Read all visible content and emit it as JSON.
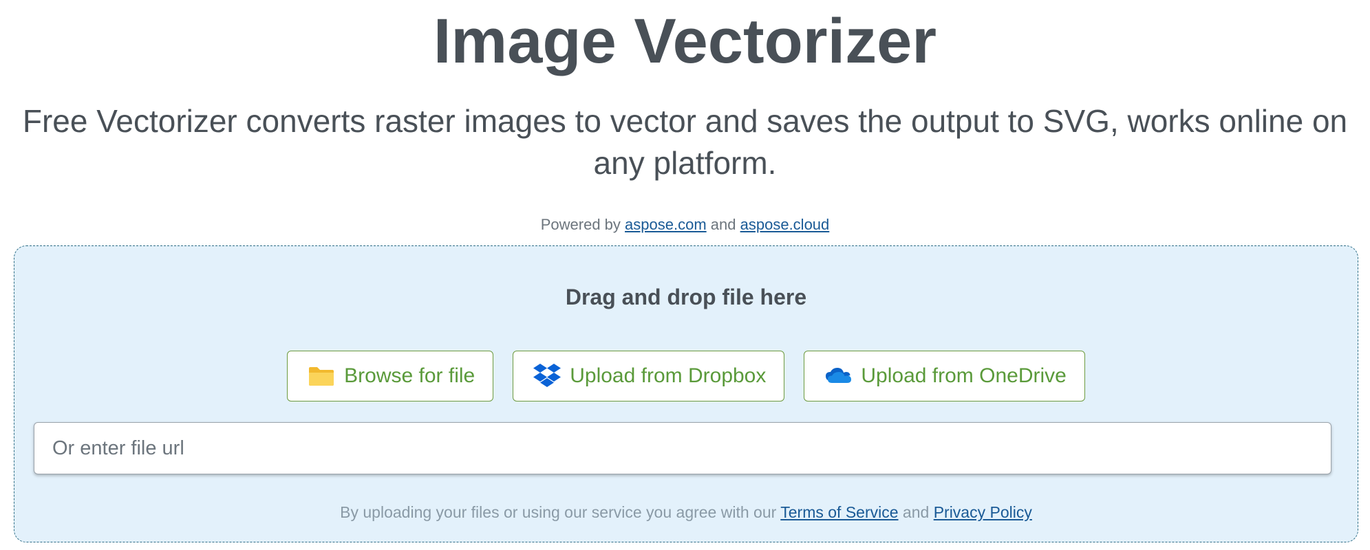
{
  "header": {
    "title": "Image Vectorizer",
    "subtitle": "Free Vectorizer converts raster images to vector and saves the output to SVG, works online on any platform."
  },
  "powered": {
    "prefix": "Powered by",
    "link1": "aspose.com",
    "conjunction": "and",
    "link2": "aspose.cloud"
  },
  "upload": {
    "drag_text": "Drag and drop file here",
    "buttons": [
      {
        "label": "Browse for file",
        "icon": "folder-icon"
      },
      {
        "label": "Upload from Dropbox",
        "icon": "dropbox-icon"
      },
      {
        "label": "Upload from OneDrive",
        "icon": "onedrive-icon"
      }
    ],
    "url_placeholder": "Or enter file url",
    "url_value": ""
  },
  "terms": {
    "prefix": "By uploading your files or using our service you agree with our",
    "tos_link": "Terms of Service",
    "conjunction": "and",
    "privacy_link": "Privacy Policy"
  },
  "colors": {
    "text": "#495057",
    "link": "#1a5a96",
    "button_text": "#5a9a3a",
    "button_border": "#6c9a3e",
    "dropzone_bg": "#e3f1fb",
    "dropzone_border": "#2e6e86"
  }
}
